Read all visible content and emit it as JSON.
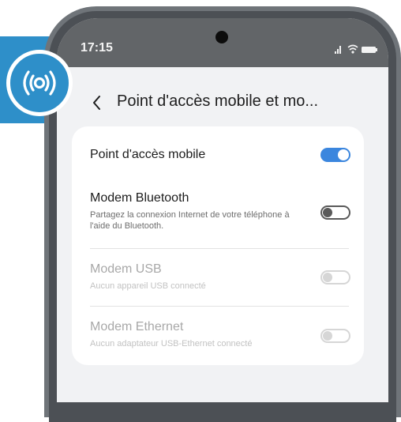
{
  "status_bar": {
    "time": "17:15"
  },
  "header": {
    "title": "Point d'accès mobile et mo..."
  },
  "settings": [
    {
      "title": "Point d'accès mobile",
      "description": "",
      "toggle": "on",
      "enabled": true
    },
    {
      "title": "Modem Bluetooth",
      "description": "Partagez la connexion Internet de votre téléphone à l'aide du Bluetooth.",
      "toggle": "off",
      "enabled": true
    },
    {
      "title": "Modem USB",
      "description": "Aucun appareil USB connecté",
      "toggle": "off",
      "enabled": false
    },
    {
      "title": "Modem Ethernet",
      "description": "Aucun adaptateur USB-Ethernet connecté",
      "toggle": "off",
      "enabled": false
    }
  ],
  "icons": {
    "badge": "hotspot-icon",
    "back": "back-arrow-icon",
    "signal": "signal-icon",
    "wifi": "wifi-icon",
    "battery": "battery-icon"
  },
  "colors": {
    "accent": "#3b86de",
    "badge": "#2e8fc9"
  }
}
